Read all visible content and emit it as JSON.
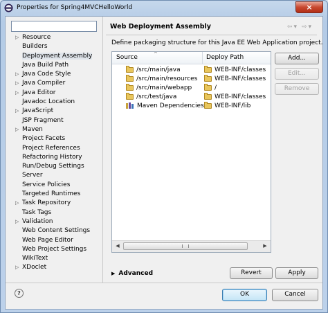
{
  "window": {
    "title": "Properties for Spring4MVCHelloWorld",
    "close_label": "×"
  },
  "filter": {
    "value": "",
    "placeholder": ""
  },
  "tree": [
    {
      "label": "Resource",
      "expandable": true
    },
    {
      "label": "Builders",
      "expandable": false
    },
    {
      "label": "Deployment Assembly",
      "expandable": false,
      "selected": true
    },
    {
      "label": "Java Build Path",
      "expandable": false
    },
    {
      "label": "Java Code Style",
      "expandable": true
    },
    {
      "label": "Java Compiler",
      "expandable": true
    },
    {
      "label": "Java Editor",
      "expandable": true
    },
    {
      "label": "Javadoc Location",
      "expandable": false
    },
    {
      "label": "JavaScript",
      "expandable": true
    },
    {
      "label": "JSP Fragment",
      "expandable": false
    },
    {
      "label": "Maven",
      "expandable": true
    },
    {
      "label": "Project Facets",
      "expandable": false
    },
    {
      "label": "Project References",
      "expandable": false
    },
    {
      "label": "Refactoring History",
      "expandable": false
    },
    {
      "label": "Run/Debug Settings",
      "expandable": false
    },
    {
      "label": "Server",
      "expandable": false
    },
    {
      "label": "Service Policies",
      "expandable": false
    },
    {
      "label": "Targeted Runtimes",
      "expandable": false
    },
    {
      "label": "Task Repository",
      "expandable": true
    },
    {
      "label": "Task Tags",
      "expandable": false
    },
    {
      "label": "Validation",
      "expandable": true
    },
    {
      "label": "Web Content Settings",
      "expandable": false
    },
    {
      "label": "Web Page Editor",
      "expandable": false
    },
    {
      "label": "Web Project Settings",
      "expandable": false
    },
    {
      "label": "WikiText",
      "expandable": false
    },
    {
      "label": "XDoclet",
      "expandable": true
    }
  ],
  "panel": {
    "title": "Web Deployment Assembly",
    "description": "Define packaging structure for this Java EE Web Application project.",
    "nav": {
      "back": "⇦",
      "back_menu": "▾",
      "forward": "⇨",
      "forward_menu": "▾"
    }
  },
  "table": {
    "columns": [
      "Source",
      "Deploy Path"
    ],
    "rows": [
      {
        "source": "/src/main/java",
        "deploy": "WEB-INF/classes",
        "icon": "folder-icon"
      },
      {
        "source": "/src/main/resources",
        "deploy": "WEB-INF/classes",
        "icon": "folder-icon"
      },
      {
        "source": "/src/main/webapp",
        "deploy": "/",
        "icon": "folder-icon"
      },
      {
        "source": "/src/test/java",
        "deploy": "WEB-INF/classes",
        "icon": "folder-icon"
      },
      {
        "source": "Maven Dependencies",
        "deploy": "WEB-INF/lib",
        "icon": "library-icon"
      }
    ]
  },
  "buttons": {
    "add": "Add...",
    "edit": "Edit...",
    "remove": "Remove",
    "revert": "Revert",
    "apply": "Apply",
    "ok": "OK",
    "cancel": "Cancel"
  },
  "advanced": {
    "label": "Advanced",
    "arrow": "▶"
  },
  "help": {
    "glyph": "?"
  },
  "colors": {
    "accent": "#3c7fb1",
    "selection": "#dfe4ea",
    "folder": "#e9c65c"
  }
}
